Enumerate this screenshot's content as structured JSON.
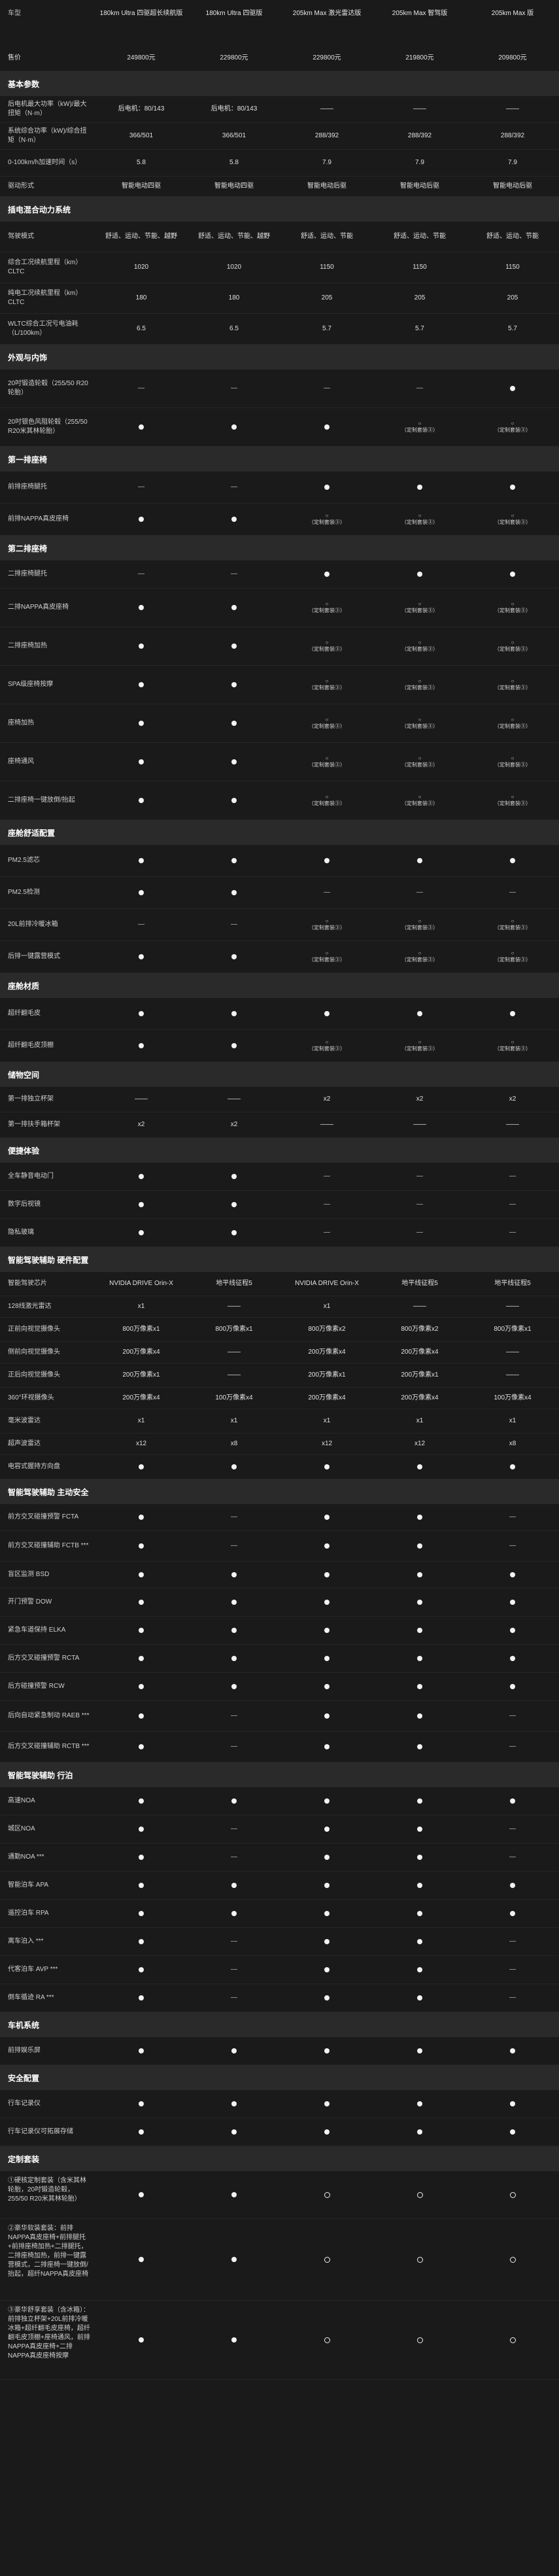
{
  "labels": {
    "model": "车型",
    "price": "售价"
  },
  "models": [
    "180km Ultra 四驱超长续航版",
    "180km Ultra 四驱版",
    "205km Max 激光雷达版",
    "205km Max 智驾版",
    "205km Max 版"
  ],
  "prices": [
    "249800元",
    "229800元",
    "229800元",
    "219800元",
    "209800元"
  ],
  "option_note": "（定制套装③）",
  "sections": {
    "basic": "基本参数",
    "elec": "插电混合动力系统",
    "ext": "外观与内饰",
    "row1": "第一排座椅",
    "row2": "第二排座椅",
    "comfort": "座舱舒适配置",
    "material": "座舱材质",
    "storage": "储物空间",
    "conv": "便捷体验",
    "adas_hw": "智能驾驶辅助 硬件配置",
    "adas_safe": "智能驾驶辅助 主动安全",
    "adas_drive": "智能驾驶辅助 行泊",
    "system": "车机系统",
    "security": "安全配置",
    "custom": "定制套装"
  },
  "rows": {
    "r1": {
      "label": "后电机最大功率（kW)/最大扭矩（N·m）",
      "v": [
        "后电机：80/143",
        "后电机：80/143",
        "——",
        "——",
        "——"
      ]
    },
    "r2": {
      "label": "系统综合功率（kW)/综合扭矩（N·m）",
      "v": [
        "366/501",
        "366/501",
        "288/392",
        "288/392",
        "288/392"
      ]
    },
    "r3": {
      "label": "0-100km/h加速时间（s）",
      "v": [
        "5.8",
        "5.8",
        "7.9",
        "7.9",
        "7.9"
      ]
    },
    "r4": {
      "label": "驱动形式",
      "v": [
        "智能电动四驱",
        "智能电动四驱",
        "智能电动后驱",
        "智能电动后驱",
        "智能电动后驱"
      ]
    },
    "r5": {
      "label": "驾驶模式",
      "v": [
        "舒适、运动、节能、越野",
        "舒适、运动、节能、越野",
        "舒适、运动、节能",
        "舒适、运动、节能",
        "舒适、运动、节能"
      ]
    },
    "r6": {
      "label": "综合工况续航里程（km）CLTC",
      "v": [
        "1020",
        "1020",
        "1150",
        "1150",
        "1150"
      ]
    },
    "r7": {
      "label": "纯电工况续航里程（km）CLTC",
      "v": [
        "180",
        "180",
        "205",
        "205",
        "205"
      ]
    },
    "r8": {
      "label": "WLTC综合工况亏电油耗（L/100km）",
      "v": [
        "6.5",
        "6.5",
        "5.7",
        "5.7",
        "5.7"
      ]
    },
    "r9": {
      "label": "20吋锻造轮毂（255/50 R20轮胎）"
    },
    "r10": {
      "label": "20吋银色风阻轮毂（255/50 R20米其林轮胎）"
    },
    "r11": {
      "label": "前排座椅腿托"
    },
    "r12": {
      "label": "前排NAPPA真皮座椅"
    },
    "r13": {
      "label": "二排座椅腿托"
    },
    "r14": {
      "label": "二排NAPPA真皮座椅"
    },
    "r15": {
      "label": "二排座椅加热"
    },
    "r16": {
      "label": "SPA级座椅按摩"
    },
    "r17": {
      "label": "座椅加热"
    },
    "r18": {
      "label": "座椅通风"
    },
    "r19": {
      "label": "二排座椅一键放倒/抬起"
    },
    "r20": {
      "label": "PM2.5滤芯"
    },
    "r21": {
      "label": "PM2.5检测"
    },
    "r22": {
      "label": "20L前排冷暖冰箱"
    },
    "r23": {
      "label": "后排一键露营模式"
    },
    "r24": {
      "label": "超纤翻毛皮"
    },
    "r25": {
      "label": "超纤翻毛皮顶棚"
    },
    "r26": {
      "label": "第一排独立杯架",
      "v": [
        "——",
        "——",
        "x2",
        "x2",
        "x2"
      ]
    },
    "r27": {
      "label": "第一排扶手箱杯架",
      "v": [
        "x2",
        "x2",
        "——",
        "——",
        "——"
      ]
    },
    "r28": {
      "label": "全车静音电动门"
    },
    "r29": {
      "label": "数字后视镜"
    },
    "r30": {
      "label": "隐私玻璃"
    },
    "r31": {
      "label": "智能驾驶芯片",
      "v": [
        "NVIDIA DRIVE Orin-X",
        "地平线征程5",
        "NVIDIA DRIVE Orin-X",
        "地平线征程5",
        "地平线征程5"
      ]
    },
    "r32": {
      "label": "128线激光雷达",
      "v": [
        "x1",
        "——",
        "x1",
        "——",
        "——"
      ]
    },
    "r33": {
      "label": "正前向视觉摄像头",
      "v": [
        "800万像素x1",
        "800万像素x1",
        "800万像素x2",
        "800万像素x2",
        "800万像素x1"
      ]
    },
    "r34": {
      "label": "侧前向视觉摄像头",
      "v": [
        "200万像素x4",
        "——",
        "200万像素x4",
        "200万像素x4",
        "——"
      ]
    },
    "r35": {
      "label": "正后向视觉摄像头",
      "v": [
        "200万像素x1",
        "——",
        "200万像素x1",
        "200万像素x1",
        "——"
      ]
    },
    "r36": {
      "label": "360°环视摄像头",
      "v": [
        "200万像素x4",
        "100万像素x4",
        "200万像素x4",
        "200万像素x4",
        "100万像素x4"
      ]
    },
    "r37": {
      "label": "毫米波雷达",
      "v": [
        "x1",
        "x1",
        "x1",
        "x1",
        "x1"
      ]
    },
    "r38": {
      "label": "超声波雷达",
      "v": [
        "x12",
        "x8",
        "x12",
        "x12",
        "x8"
      ]
    },
    "r39": {
      "label": "电容式握持方向盘"
    },
    "r40": {
      "label": "前方交叉碰撞预警 FCTA"
    },
    "r41": {
      "label": "前方交叉碰撞辅助 FCTB ***"
    },
    "r42": {
      "label": "盲区监测 BSD"
    },
    "r43": {
      "label": "开门预警 DOW"
    },
    "r44": {
      "label": "紧急车道保持 ELKA"
    },
    "r45": {
      "label": "后方交叉碰撞预警 RCTA"
    },
    "r46": {
      "label": "后方碰撞预警 RCW"
    },
    "r47": {
      "label": "后向自动紧急制动 RAEB ***"
    },
    "r48": {
      "label": "后方交叉碰撞辅助 RCTB ***"
    },
    "r49": {
      "label": "高速NOA"
    },
    "r50": {
      "label": "城区NOA"
    },
    "r51": {
      "label": "通勤NOA ***"
    },
    "r52": {
      "label": "智能泊车 APA"
    },
    "r53": {
      "label": "遥控泊车 RPA"
    },
    "r54": {
      "label": "离车泊入 ***"
    },
    "r55": {
      "label": "代客泊车 AVP ***"
    },
    "r56": {
      "label": "倒车循迹 RA ***"
    },
    "r57": {
      "label": "前排娱乐屏"
    },
    "r58": {
      "label": "行车记录仪"
    },
    "r59": {
      "label": "行车记录仪可拓展存储"
    },
    "r60": {
      "label": "①硬核定制套装（含米其林轮胎，20吋锻造轮毂，255/50 R20米其林轮胎）"
    },
    "r61": {
      "label": "②豪华软装套装：前排NAPPA真皮座椅+前排腿托+前排座椅加热+二排腿托，二排座椅加热，前排一键露营模式，二排座椅一键放倒/抬起，超纤NAPPA真皮座椅"
    },
    "r62": {
      "label": "③豪华舒享套装（含冰箱）：前排独立杯架+20L前排冷暖冰箱+超纤翻毛皮座椅，超纤翻毛皮顶棚+座椅通风，前排NAPPA真皮座椅+二排NAPPA真皮座椅按摩"
    }
  }
}
